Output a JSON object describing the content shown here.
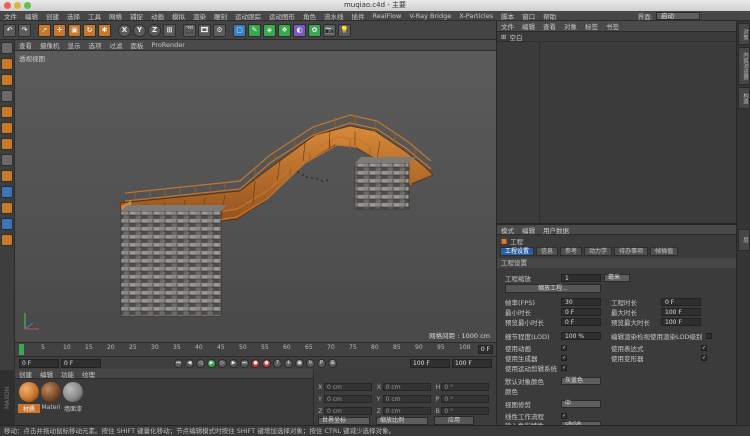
{
  "window": {
    "title": "muqiao.c4d - 主要"
  },
  "menu": [
    "文件",
    "编辑",
    "创建",
    "选择",
    "工具",
    "网格",
    "捕捉",
    "动画",
    "模拟",
    "渲染",
    "雕刻",
    "运动跟踪",
    "运动图形",
    "角色",
    "流水线",
    "插件",
    "RealFlow",
    "V-Ray Bridge",
    "X-Particles",
    "脚本",
    "窗口",
    "帮助"
  ],
  "layout": {
    "label": "界面:",
    "value": "启动"
  },
  "viewport_menu": [
    "查看",
    "摄像机",
    "显示",
    "选项",
    "过滤",
    "面板",
    "ProRender"
  ],
  "viewport": {
    "label": "透视视图",
    "grid_info": "网格间距 : 1000 cm"
  },
  "timeline": {
    "ticks": [
      "0",
      "5",
      "10",
      "15",
      "20",
      "25",
      "30",
      "35",
      "40",
      "45",
      "50",
      "55",
      "60",
      "65",
      "70",
      "75",
      "80",
      "85",
      "90",
      "95",
      "100"
    ],
    "end_label": "0 F"
  },
  "transport": {
    "start": "0 F",
    "current": "0 F",
    "end": "100 F",
    "max": "100 F"
  },
  "material_menu": [
    "创建",
    "编辑",
    "功能",
    "纹理"
  ],
  "materials": [
    {
      "name": "材质",
      "color": "#c9752e"
    },
    {
      "name": "Materi",
      "color": "#7a4a2a"
    },
    {
      "name": "墙面漆",
      "color": "#8a8a8a"
    }
  ],
  "coords": {
    "rows": [
      {
        "a": "X",
        "av": "0 cm",
        "b": "X",
        "bv": "0 cm",
        "c": "H",
        "cv": "0 °"
      },
      {
        "a": "Y",
        "av": "0 cm",
        "b": "Y",
        "bv": "0 cm",
        "c": "P",
        "cv": "0 °"
      },
      {
        "a": "Z",
        "av": "0 cm",
        "b": "Z",
        "bv": "0 cm",
        "c": "B",
        "cv": "0 °"
      }
    ],
    "world": "世界坐标",
    "scale": "缩放比例",
    "apply": "应用"
  },
  "status": "移动：点击并拖动鼠标移动元素。按住 SHIFT 键量化移动；节点编辑模式时按住 SHIFT 键增加选择对象；按住 CTRL 键减少选择对象。",
  "object_menu": [
    "文件",
    "编辑",
    "查看",
    "对象",
    "标签",
    "书签"
  ],
  "object_row": "空白",
  "right_tabs": [
    "对象",
    "内容浏览器",
    "构造",
    "层"
  ],
  "attr": {
    "menu": [
      "模式",
      "编辑",
      "用户数据"
    ],
    "title": "工程",
    "tabs": [
      "工程设置",
      "信息",
      "参考",
      "动力学",
      "待办事项",
      "帧插值"
    ],
    "section": "工程设置",
    "scale_label": "工程缩放",
    "scale_value": "1",
    "scale_unit": "毫米",
    "scale_button": "缩放工程...",
    "fps_label": "帧率(FPS)",
    "fps_value": "30",
    "min_label": "最小时长",
    "min_value": "0 F",
    "preview_min_label": "预览最小时长",
    "preview_min_value": "0 F",
    "length_label": "工程时长",
    "length_value": "0 F",
    "max_label": "最大时长",
    "max_value": "100 F",
    "preview_max_label": "预览最大时长",
    "preview_max_value": "100 F",
    "lod_label": "细节程度(LOD)",
    "lod_value": "100 %",
    "lod_render_label": "编辑渲染检视使用渲染LOD级别",
    "anim_label": "使用动画",
    "gen_label": "使用生成器",
    "motion_label": "使用运动剪辑系统",
    "expr_label": "使用表达式",
    "deform_label": "使用变形器",
    "objcolor_label": "默认对象颜色",
    "objcolor_value": "灰蓝色",
    "color_label": "颜色",
    "viewclip_label": "视图修剪",
    "viewclip_value": "中",
    "linear_label": "线性工作流程",
    "inputcolor_label": "输入色彩特性",
    "inputcolor_value": "sRGB"
  }
}
